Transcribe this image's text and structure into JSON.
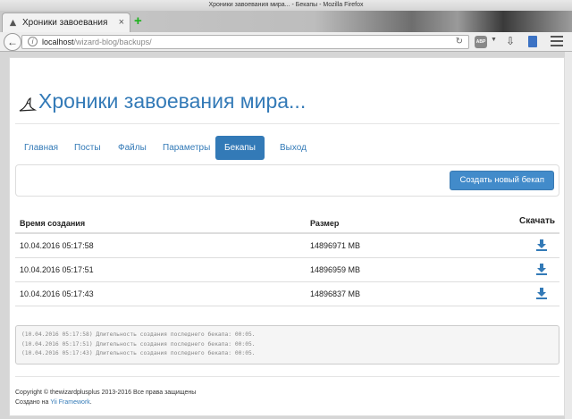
{
  "window": {
    "title": "Хроники завоевания мира... - Бекапы - Mozilla Firefox"
  },
  "tab": {
    "title": "Хроники завоевания ми...",
    "close": "×"
  },
  "new_tab": "+",
  "address_bar": {
    "host": "localhost",
    "path": "/wizard-blog/backups/"
  },
  "toolbar_icons": {
    "adblock": "ABP",
    "back": "back-arrow-icon",
    "reload": "reload-icon",
    "download": "download-icon",
    "bookmarks": "bookmarks-icon",
    "menu": "hamburger-menu-icon"
  },
  "site": {
    "title": "Хроники завоевания мира..."
  },
  "nav": {
    "items": [
      {
        "label": "Главная",
        "active": false
      },
      {
        "label": "Посты",
        "active": false
      },
      {
        "label": "Файлы",
        "active": false
      },
      {
        "label": "Параметры",
        "active": false
      },
      {
        "label": "Бекапы",
        "active": true
      },
      {
        "label": "Выход",
        "active": false
      }
    ]
  },
  "actions": {
    "create_backup": "Создать новый бекап"
  },
  "table": {
    "headers": {
      "created": "Время создания",
      "size": "Размер",
      "download": "Скачать"
    },
    "rows": [
      {
        "created": "10.04.2016 05:17:58",
        "size": "14896971 MB"
      },
      {
        "created": "10.04.2016 05:17:51",
        "size": "14896959 MB"
      },
      {
        "created": "10.04.2016 05:17:43",
        "size": "14896837 MB"
      }
    ]
  },
  "log": {
    "lines": [
      "(10.04.2016 05:17:58) Длительность создания последнего бекапа: 00:05.",
      "(10.04.2016 05:17:51) Длительность создания последнего бекапа: 00:05.",
      "(10.04.2016 05:17:43) Длительность создания последнего бекапа: 00:05."
    ]
  },
  "footer": {
    "copyright": "Copyright © thewizardplusplus 2013-2016 Все права защищены",
    "created_with_prefix": "Создано на ",
    "framework_link": "Yii Framework",
    "created_with_suffix": "."
  },
  "colors": {
    "accent": "#337ab7",
    "button": "#428bca",
    "new_tab": "#1bb21b"
  }
}
